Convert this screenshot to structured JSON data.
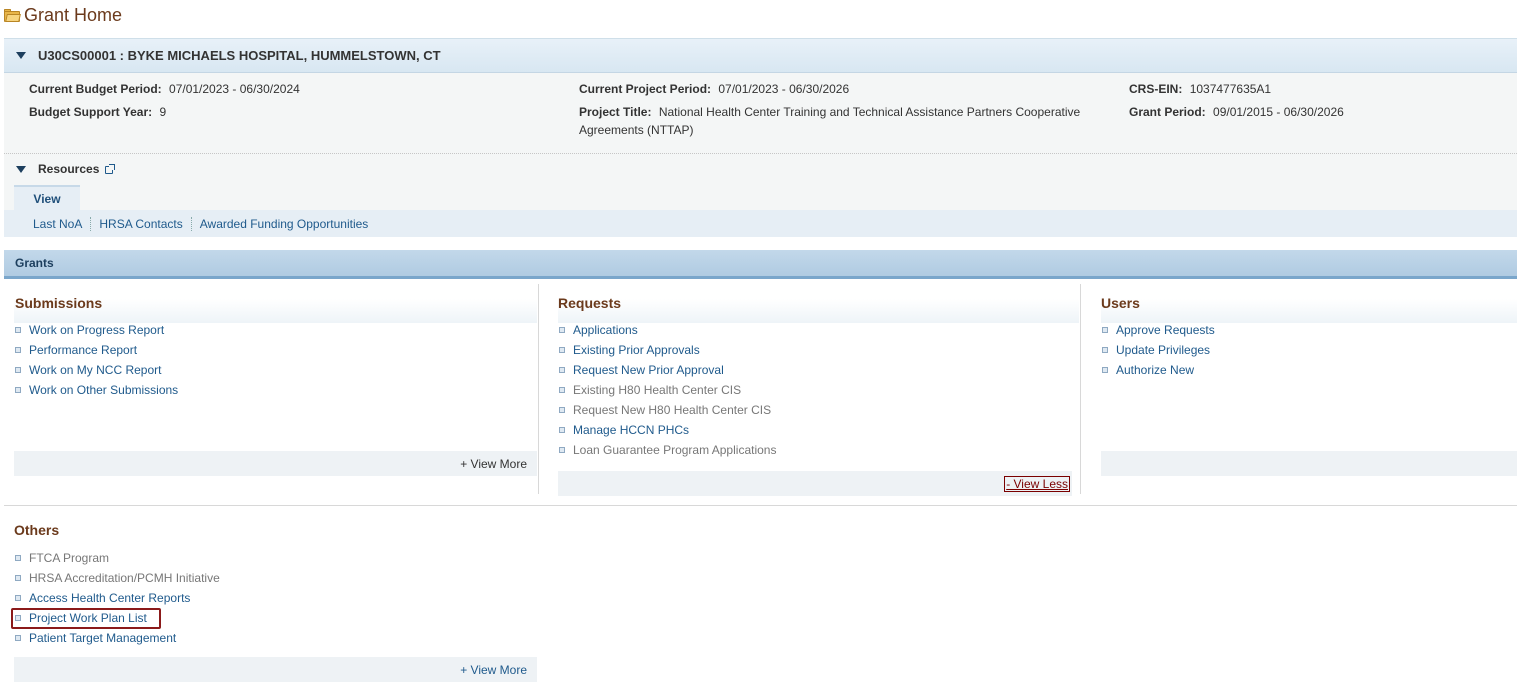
{
  "page": {
    "title": "Grant Home"
  },
  "grant": {
    "header": "U30CS00001 : BYKE MICHAELS HOSPITAL, HUMMELSTOWN, CT",
    "fields": {
      "current_budget_period_label": "Current Budget Period:",
      "current_budget_period_value": "07/01/2023 - 06/30/2024",
      "budget_support_year_label": "Budget Support Year:",
      "budget_support_year_value": "9",
      "current_project_period_label": "Current Project Period:",
      "current_project_period_value": "07/01/2023 - 06/30/2026",
      "project_title_label": "Project Title:",
      "project_title_value_line1": "National Health Center Training and Technical Assistance Partners Cooperative",
      "project_title_value_line2": "Agreements (NTTAP)",
      "crs_ein_label": "CRS-EIN:",
      "crs_ein_value": "1037477635A1",
      "grant_period_label": "Grant Period:",
      "grant_period_value": "09/01/2015 - 06/30/2026"
    }
  },
  "resources": {
    "label": "Resources",
    "view_tab": "View",
    "links": [
      "Last NoA",
      "HRSA Contacts",
      "Awarded Funding Opportunities"
    ]
  },
  "grants_bar": {
    "label": "Grants"
  },
  "submissions": {
    "title": "Submissions",
    "items": [
      {
        "label": "Work on Progress Report",
        "enabled": true
      },
      {
        "label": "Performance Report",
        "enabled": true
      },
      {
        "label": "Work on My NCC Report",
        "enabled": true
      },
      {
        "label": "Work on Other Submissions",
        "enabled": true
      }
    ],
    "footer_link": "+ View More"
  },
  "requests": {
    "title": "Requests",
    "items": [
      {
        "label": "Applications",
        "enabled": true
      },
      {
        "label": "Existing Prior Approvals",
        "enabled": true
      },
      {
        "label": "Request New Prior Approval",
        "enabled": true
      },
      {
        "label": "Existing H80 Health Center CIS",
        "enabled": false
      },
      {
        "label": "Request New H80 Health Center CIS",
        "enabled": false
      },
      {
        "label": "Manage HCCN PHCs",
        "enabled": true
      },
      {
        "label": "Loan Guarantee Program Applications",
        "enabled": false
      }
    ],
    "footer_link": "- View Less"
  },
  "users": {
    "title": "Users",
    "items": [
      {
        "label": "Approve Requests",
        "enabled": true
      },
      {
        "label": "Update Privileges",
        "enabled": true
      },
      {
        "label": "Authorize New",
        "enabled": true
      }
    ]
  },
  "others": {
    "title": "Others",
    "items": [
      {
        "label": "FTCA Program",
        "enabled": false
      },
      {
        "label": "HRSA Accreditation/PCMH Initiative",
        "enabled": false
      },
      {
        "label": "Access Health Center Reports",
        "enabled": true
      },
      {
        "label": "Project Work Plan List",
        "enabled": true
      },
      {
        "label": "Patient Target Management",
        "enabled": true
      }
    ],
    "footer_link": "+ View More"
  },
  "colors": {
    "title_brown": "#6b3a1c",
    "link_blue": "#1f5a8c",
    "disabled_gray": "#777777",
    "highlight_red": "#8b1a1a"
  }
}
